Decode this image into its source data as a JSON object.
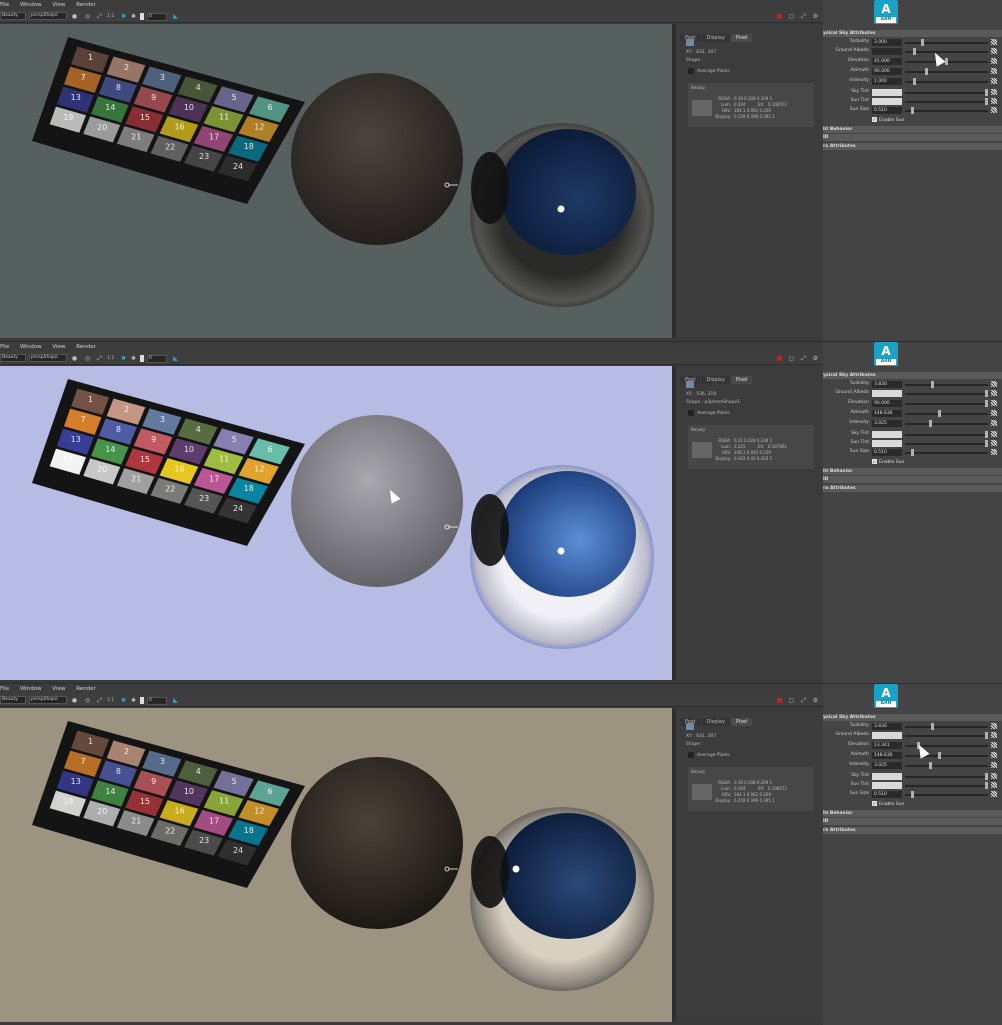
{
  "menu": [
    "File",
    "Window",
    "View",
    "Render"
  ],
  "toolbar": {
    "aov_value": "Beauty",
    "camera_value": "perspShape",
    "ratio_label": "1:1",
    "exposure_value": "0"
  },
  "info_tabs": [
    "Post",
    "Display",
    "Pixel"
  ],
  "info_labels": {
    "average_pixels": "Average Pixels",
    "beauty": "Beauty",
    "rgba": "RGBA:",
    "lum": "Lum:",
    "ev": "EV:",
    "hsv": "HSV:",
    "display": "Display:"
  },
  "logo": {
    "letter": "A",
    "badge": "ARN"
  },
  "attr_labels": {
    "section_title": "ysical Sky Attributes",
    "turbidity": "Turbidity",
    "ground_albedo": "Ground Albedo",
    "elevation": "Elevation",
    "azimuth": "Azimuth",
    "intensity": "Intensity",
    "sky_tint": "Sky Tint",
    "sun_tint": "Sun Tint",
    "sun_size": "Sun Size",
    "enable_sun": "Enable Sun",
    "sec_behavior": "ht Behavior",
    "sec_id": "ID",
    "sec_extra": "ra Attributes"
  },
  "chart": {
    "patches": [
      {
        "n": "1",
        "c": "#735244"
      },
      {
        "n": "2",
        "c": "#c29682"
      },
      {
        "n": "3",
        "c": "#627a9d"
      },
      {
        "n": "4",
        "c": "#576c43"
      },
      {
        "n": "5",
        "c": "#8580b1"
      },
      {
        "n": "6",
        "c": "#67bdaa"
      },
      {
        "n": "7",
        "c": "#d67e2c"
      },
      {
        "n": "8",
        "c": "#505ba6"
      },
      {
        "n": "9",
        "c": "#c15a63"
      },
      {
        "n": "10",
        "c": "#5e3c6c"
      },
      {
        "n": "11",
        "c": "#9dbc40"
      },
      {
        "n": "12",
        "c": "#e0a32e"
      },
      {
        "n": "13",
        "c": "#383d96"
      },
      {
        "n": "14",
        "c": "#469449"
      },
      {
        "n": "15",
        "c": "#af363c"
      },
      {
        "n": "16",
        "c": "#e7c71f"
      },
      {
        "n": "17",
        "c": "#bb5695"
      },
      {
        "n": "18",
        "c": "#0885a1"
      },
      {
        "n": "19",
        "c": "#f3f3f2"
      },
      {
        "n": "20",
        "c": "#c8c8c8"
      },
      {
        "n": "21",
        "c": "#a0a0a0"
      },
      {
        "n": "22",
        "c": "#7a7a79"
      },
      {
        "n": "23",
        "c": "#555555"
      },
      {
        "n": "24",
        "c": "#343434"
      }
    ]
  },
  "panels": [
    {
      "info": {
        "xy": "XY : 831, 307",
        "shape": "Shape :",
        "rgba": "0.19  0.208  0.209  1",
        "lum": "0.204",
        "ev": "0.108572",
        "hsv": "184.1  0.061  0.209",
        "display": "0.259  0.396  0.395  1"
      },
      "attrs": {
        "turbidity": "3.000",
        "elevation": "45.000",
        "azimuth": "90.000",
        "intensity": "1.000",
        "sun_size": "0.510"
      },
      "levels": {
        "turbidity": 0.2,
        "ground_albedo": 0.1,
        "elevation": 0.5,
        "azimuth": 0.25,
        "intensity": 0.1,
        "sun_size": 0.08
      }
    },
    {
      "info": {
        "xy": "XY : 536, 319",
        "shape": "Shape : pSphereShape1",
        "rgba": "0.21  0.228  0.239  1",
        "lum": "0.225",
        "ev": "0.347961",
        "hsv": "248.1  0.045  0.239",
        "display": "0.422  0.42  0.433  1"
      },
      "attrs": {
        "turbidity": "3.830",
        "elevation": "90.000",
        "azimuth": "148.636",
        "intensity": "3.025",
        "sun_size": "0.510"
      },
      "levels": {
        "turbidity": 0.32,
        "ground_albedo": 1.0,
        "elevation": 1.0,
        "azimuth": 0.41,
        "intensity": 0.3,
        "sun_size": 0.08
      }
    },
    {
      "info": {
        "xy": "XY : 831, 307",
        "shape": "Shape :",
        "rgba": "0.19  0.208  0.209  1",
        "lum": "0.204",
        "ev": "0.108572",
        "hsv": "184.1  0.061  0.209",
        "display": "0.259  0.396  0.395  1"
      },
      "attrs": {
        "turbidity": "3.830",
        "elevation": "13.341",
        "azimuth": "148.636",
        "intensity": "3.025",
        "sun_size": "0.510"
      },
      "levels": {
        "turbidity": 0.32,
        "ground_albedo": 1.0,
        "elevation": 0.15,
        "azimuth": 0.41,
        "intensity": 0.3,
        "sun_size": 0.08
      }
    }
  ],
  "colors": {
    "arnold_blue": "#19a2c6",
    "stop_red": "#d02020"
  }
}
